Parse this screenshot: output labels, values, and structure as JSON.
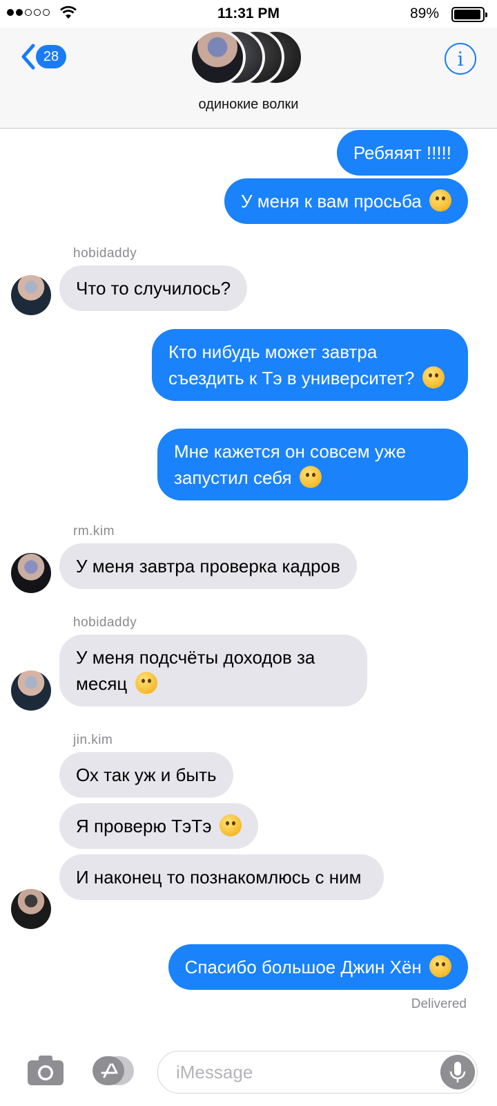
{
  "status_bar": {
    "time": "11:31 PM",
    "battery_percent": "89%",
    "signal_bars_filled": 2,
    "signal_bars_total": 5
  },
  "header": {
    "back_badge": "28",
    "group_name": "одинокие волки",
    "info_label": "i"
  },
  "messages": [
    {
      "direction": "out",
      "text": "Ребяяят !!!!!"
    },
    {
      "direction": "out",
      "text": "У меня к вам просьба",
      "emoji": "winking-tongue-emoji"
    },
    {
      "direction": "in",
      "sender": "hobidaddy",
      "text": "Что то случилось?"
    },
    {
      "direction": "out",
      "text": "Кто нибудь может завтра съездить к Тэ в университет?",
      "emoji": "grimacing-emoji"
    },
    {
      "direction": "out",
      "text": "Мне кажется он совсем уже запустил себя",
      "emoji": "crying-emoji"
    },
    {
      "direction": "in",
      "sender": "rm.kim",
      "text": "У меня завтра проверка кадров"
    },
    {
      "direction": "in",
      "sender": "hobidaddy",
      "text": "У меня подсчёты доходов за месяц",
      "emoji": "grimacing-emoji"
    },
    {
      "direction": "in",
      "sender": "jin.kim",
      "text": "Ох так уж и быть"
    },
    {
      "direction": "in",
      "text": "Я проверю ТэТэ",
      "emoji": "winking-tongue-emoji"
    },
    {
      "direction": "in",
      "text": "И наконец то познакомлюсь с ним"
    },
    {
      "direction": "out",
      "text": "Спасибо большое Джин Хён",
      "emoji": "dizzy-face-emoji"
    }
  ],
  "delivered_label": "Delivered",
  "input": {
    "placeholder": "iMessage"
  },
  "colors": {
    "outgoing_bubble": "#1a82fb",
    "incoming_bubble": "#e6e5eb",
    "accent": "#1a7cf5"
  }
}
